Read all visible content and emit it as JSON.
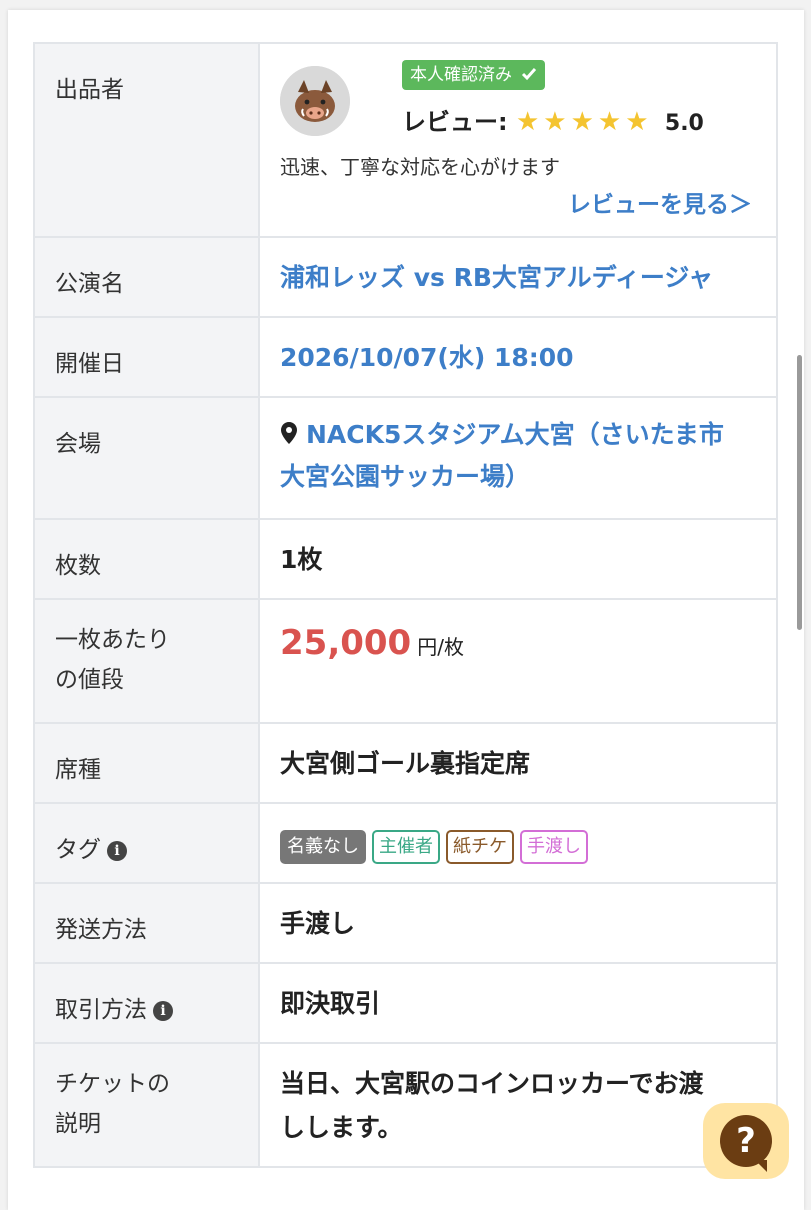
{
  "seller": {
    "label": "出品者",
    "verified_badge": "本人確認済み",
    "review_label": "レビュー:",
    "rating": 5,
    "rating_text": "5.0",
    "comment": "迅速、丁寧な対応を心がけます",
    "review_link": "レビューを見る＞"
  },
  "rows": {
    "event": {
      "label": "公演名",
      "value": "浦和レッズ vs RB大宮アルディージャ"
    },
    "date": {
      "label": "開催日",
      "value": "2026/10/07(水) 18:00"
    },
    "venue": {
      "label": "会場",
      "value_line1": "NACK5スタジアム大宮（さいたま市",
      "value_line2": "大宮公園サッカー場）"
    },
    "count": {
      "label": "枚数",
      "value": "1枚"
    },
    "price": {
      "label_line1": "一枚あたり",
      "label_line2": "の値段",
      "value": "25,000",
      "unit": "円/枚"
    },
    "seat": {
      "label": "席種",
      "value": "大宮側ゴール裏指定席"
    },
    "tags": {
      "label": "タグ",
      "items": [
        {
          "text": "名義なし",
          "color": "#777777",
          "style": "filled"
        },
        {
          "text": "主催者",
          "color": "#3aa886",
          "style": "outline"
        },
        {
          "text": "紙チケ",
          "color": "#8a5a2b",
          "style": "outline"
        },
        {
          "text": "手渡し",
          "color": "#d36ed6",
          "style": "outline"
        }
      ]
    },
    "shipping": {
      "label": "発送方法",
      "value": "手渡し"
    },
    "deal": {
      "label": "取引方法",
      "value": "即決取引"
    },
    "desc": {
      "label_line1": "チケットの",
      "label_line2": "説明",
      "value_line1": "当日、大宮駅のコインロッカーでお渡",
      "value_line2": "しします。"
    }
  },
  "icons": {
    "info": "info-icon",
    "pin": "location-pin-icon",
    "check": "check-icon",
    "star": "star-icon",
    "help": "help-question-icon"
  },
  "colors": {
    "link": "#3d7ec8",
    "price": "#d9534f",
    "badge": "#5cb85c",
    "star": "#f4c430",
    "help_bg": "#ffe4a3",
    "help_fg": "#6b3d12"
  }
}
